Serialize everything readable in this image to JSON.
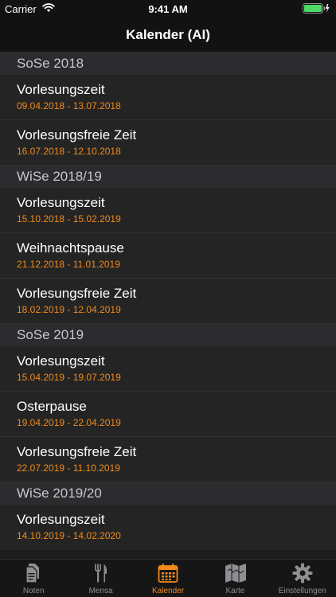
{
  "status_bar": {
    "carrier": "Carrier",
    "time": "9:41 AM"
  },
  "nav": {
    "title": "Kalender (AI)"
  },
  "colors": {
    "accent": "#f08a1d",
    "background": "#1c1c1e",
    "battery": "#4cd964"
  },
  "sections": [
    {
      "title": "SoSe 2018",
      "items": [
        {
          "label": "Vorlesungszeit",
          "dates": "09.04.2018 - 13.07.2018"
        },
        {
          "label": "Vorlesungsfreie Zeit",
          "dates": "16.07.2018 - 12.10.2018"
        }
      ]
    },
    {
      "title": "WiSe 2018/19",
      "items": [
        {
          "label": "Vorlesungszeit",
          "dates": "15.10.2018 - 15.02.2019"
        },
        {
          "label": "Weihnachtspause",
          "dates": "21.12.2018 - 11.01.2019"
        },
        {
          "label": "Vorlesungsfreie Zeit",
          "dates": "18.02.2019 - 12.04.2019"
        }
      ]
    },
    {
      "title": "SoSe 2019",
      "items": [
        {
          "label": "Vorlesungszeit",
          "dates": "15.04.2019 - 19.07.2019"
        },
        {
          "label": "Osterpause",
          "dates": "19.04.2019 - 22.04.2019"
        },
        {
          "label": "Vorlesungsfreie Zeit",
          "dates": "22.07.2019 - 11.10.2019"
        }
      ]
    },
    {
      "title": "WiSe 2019/20",
      "items": [
        {
          "label": "Vorlesungszeit",
          "dates": "14.10.2019 - 14.02.2020"
        }
      ]
    }
  ],
  "tabs": [
    {
      "label": "Noten",
      "icon": "document-icon",
      "active": false
    },
    {
      "label": "Mensa",
      "icon": "fork-knife-icon",
      "active": false
    },
    {
      "label": "Kalender",
      "icon": "calendar-icon",
      "active": true
    },
    {
      "label": "Karte",
      "icon": "map-icon",
      "active": false
    },
    {
      "label": "Einstellungen",
      "icon": "gear-icon",
      "active": false
    }
  ]
}
